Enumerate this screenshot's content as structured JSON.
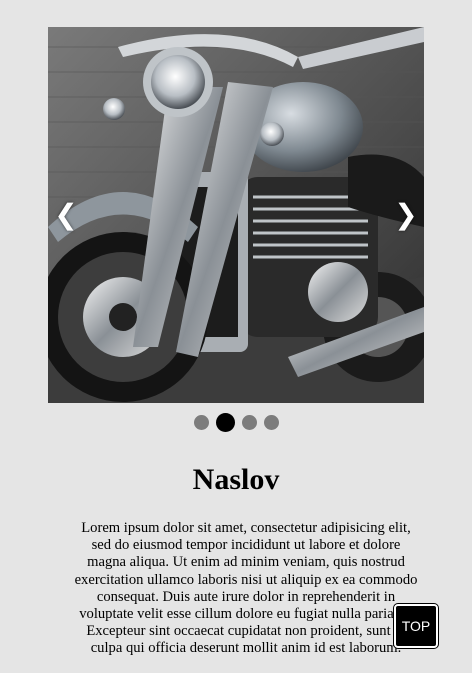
{
  "slider": {
    "image_alt": "motorcycle",
    "prev_glyph": "❮",
    "next_glyph": "❯",
    "slide_count": 4,
    "active_slide": 2
  },
  "content": {
    "title": "Naslov",
    "paragraph": "Lorem ipsum dolor sit amet, consectetur adipisicing elit, sed do eiusmod tempor incididunt ut labore et dolore magna aliqua. Ut enim ad minim veniam, quis nostrud exercitation ullamco laboris nisi ut aliquip ex ea commodo consequat. Duis aute irure dolor in reprehenderit in voluptate velit esse cillum dolore eu fugiat nulla pariatur. Excepteur sint occaecat cupidatat non proident, sunt in culpa qui officia deserunt mollit anim id est laborum."
  },
  "top_button": {
    "label": "TOP"
  },
  "colors": {
    "page_background": "#e5e5e5",
    "dot_inactive": "#7c7c7c",
    "dot_active": "#000000",
    "top_button_bg": "#000000"
  }
}
